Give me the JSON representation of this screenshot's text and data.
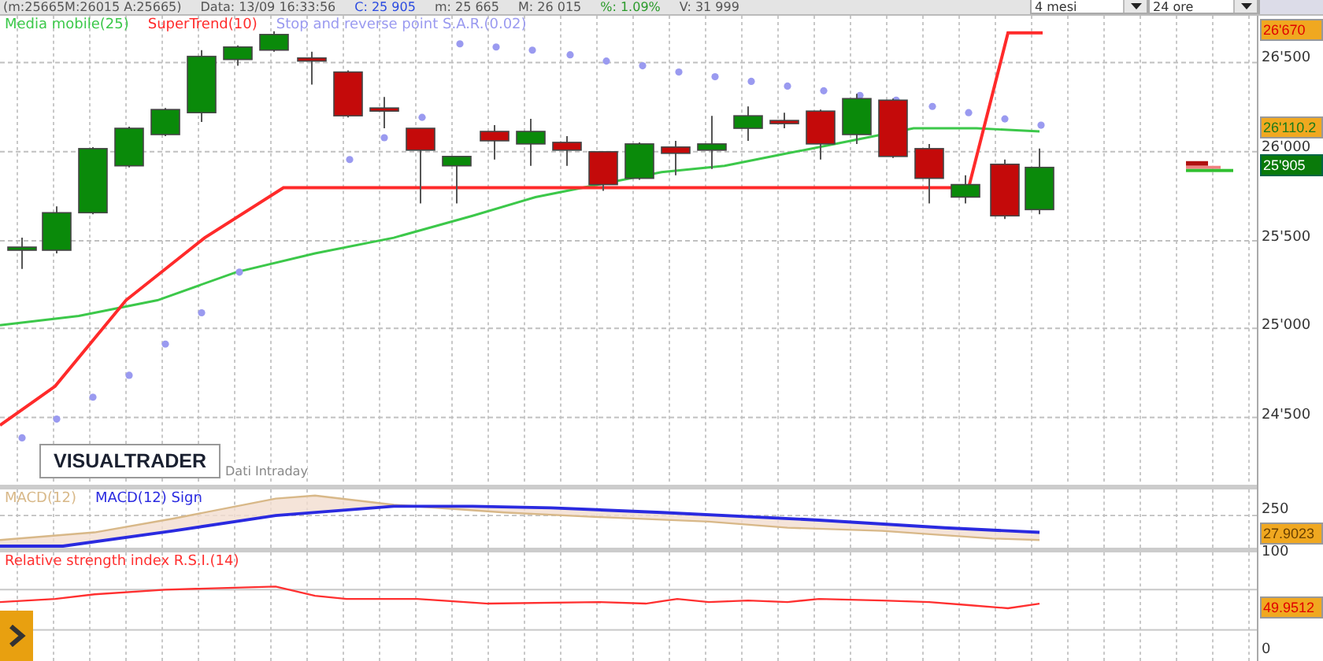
{
  "info_bar": {
    "range": "(m:25665M:26015 A:25665)",
    "date": "Data: 13/09 16:33:56",
    "close": "C: 25 905",
    "low": "m: 25 665",
    "high": "M: 26 015",
    "change": "%: 1.09%",
    "volume": "V: 31 999"
  },
  "period_select": {
    "value": "4 mesi"
  },
  "interval_select": {
    "value": "24 ore"
  },
  "main_chart": {
    "legend": [
      {
        "label": "Media mobile(25)",
        "color": "#3cc84a"
      },
      {
        "label": "SuperTrend(10)",
        "color": "#ff2a2a"
      },
      {
        "label": "Stop and reverse point S.A.R.(0.02)",
        "color": "#9a9af0"
      }
    ],
    "y_axis_labels": [
      "26'500",
      "26'000",
      "25'500",
      "25'000",
      "24'500"
    ],
    "price_tags": [
      {
        "text": "26'670",
        "kind": "supertrend"
      },
      {
        "text": "26'110.2",
        "kind": "moving-average"
      },
      {
        "text": "25'905",
        "kind": "last"
      }
    ],
    "logo": "VISUALTRADER",
    "source": "Dati Intraday"
  },
  "macd_panel": {
    "legend": [
      {
        "label": "MACD(12)",
        "color": "#d8b888"
      },
      {
        "label": "MACD(12) Sign",
        "color": "#2a2ae0"
      }
    ],
    "y_axis_labels": [
      "250"
    ],
    "price_tags": [
      {
        "text": "27.9023",
        "kind": "macd"
      }
    ]
  },
  "rsi_panel": {
    "legend": [
      {
        "label": "Relative strength index R.S.I.(14)",
        "color": "#ff3030"
      }
    ],
    "y_axis_labels": [
      "100",
      "0"
    ],
    "price_tags": [
      {
        "text": "49.9512",
        "kind": "rsi"
      }
    ]
  }
}
